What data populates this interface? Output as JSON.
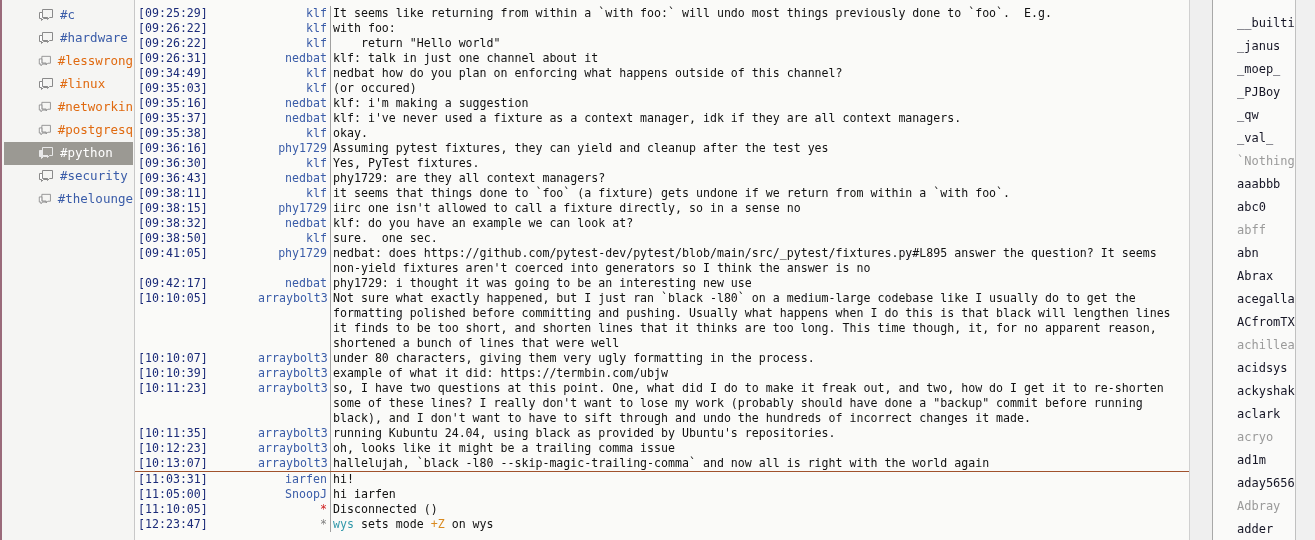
{
  "channels": [
    {
      "name": "#c",
      "color": "#3a5ca8",
      "selected": false
    },
    {
      "name": "#hardware",
      "color": "#3a5ca8",
      "selected": false
    },
    {
      "name": "#lesswrong",
      "color": "#e06a10",
      "selected": false
    },
    {
      "name": "#linux",
      "color": "#e06a10",
      "selected": false
    },
    {
      "name": "#networkin",
      "color": "#e06a10",
      "selected": false
    },
    {
      "name": "#postgresq",
      "color": "#e06a10",
      "selected": false
    },
    {
      "name": "#python",
      "color": "#ffffff",
      "selected": true
    },
    {
      "name": "#security",
      "color": "#3a5ca8",
      "selected": false
    },
    {
      "name": "#thelounge",
      "color": "#3a5ca8",
      "selected": false
    }
  ],
  "messages": [
    {
      "kind": "message",
      "time": "[09:25:29]",
      "nick": "klf",
      "text": "It seems like returning from within a `with foo:` will undo most things previously done to `foo`.  E.g."
    },
    {
      "kind": "message",
      "time": "[09:26:22]",
      "nick": "klf",
      "text": "with foo:"
    },
    {
      "kind": "message",
      "time": "[09:26:22]",
      "nick": "klf",
      "text": "    return \"Hello world\""
    },
    {
      "kind": "message",
      "time": "[09:26:31]",
      "nick": "nedbat",
      "text": "klf: talk in just one channel about it"
    },
    {
      "kind": "message",
      "time": "[09:34:49]",
      "nick": "klf",
      "text": "nedbat how do you plan on enforcing what happens outside of this channel?"
    },
    {
      "kind": "message",
      "time": "[09:35:03]",
      "nick": "klf",
      "text": "(or occured)"
    },
    {
      "kind": "message",
      "time": "[09:35:16]",
      "nick": "nedbat",
      "text": "klf: i'm making a suggestion"
    },
    {
      "kind": "message",
      "time": "[09:35:37]",
      "nick": "nedbat",
      "text": "klf: i've never used a fixture as a context manager, idk if they are all context managers."
    },
    {
      "kind": "message",
      "time": "[09:35:38]",
      "nick": "klf",
      "text": "okay."
    },
    {
      "kind": "message",
      "time": "[09:36:16]",
      "nick": "phy1729",
      "text": "Assuming pytest fixtures, they can yield and cleanup after the test yes"
    },
    {
      "kind": "message",
      "time": "[09:36:30]",
      "nick": "klf",
      "text": "Yes, PyTest fixtures."
    },
    {
      "kind": "message",
      "time": "[09:36:43]",
      "nick": "nedbat",
      "text": "phy1729: are they all context managers?"
    },
    {
      "kind": "message",
      "time": "[09:38:11]",
      "nick": "klf",
      "text": "it seems that things done to `foo` (a fixture) gets undone if we return from within a `with foo`."
    },
    {
      "kind": "message",
      "time": "[09:38:15]",
      "nick": "phy1729",
      "text": "iirc one isn't allowed to call a fixture directly, so in a sense no"
    },
    {
      "kind": "message",
      "time": "[09:38:32]",
      "nick": "nedbat",
      "text": "klf: do you have an example we can look at?"
    },
    {
      "kind": "message",
      "time": "[09:38:50]",
      "nick": "klf",
      "text": "sure.  one sec."
    },
    {
      "kind": "message",
      "time": "[09:41:05]",
      "nick": "phy1729",
      "text": "nedbat: does https://github.com/pytest-dev/pytest/blob/main/src/_pytest/fixtures.py#L895 answer the question? It seems non-yield fixtures aren't coerced into generators so I think the answer is no"
    },
    {
      "kind": "message",
      "time": "[09:42:17]",
      "nick": "nedbat",
      "text": "phy1729: i thought it was going to be an interesting new use"
    },
    {
      "kind": "message",
      "time": "[10:10:05]",
      "nick": "arraybolt3",
      "text": "Not sure what exactly happened, but I just ran `black -l80` on a medium-large codebase like I usually do to get the formatting polished before committing and pushing. Usually what happens when I do this is that black will lengthen lines it finds to be too short, and shorten lines that it thinks are too long. This time though, it, for no apparent reason, shortened a bunch of lines that were well"
    },
    {
      "kind": "message",
      "time": "[10:10:07]",
      "nick": "arraybolt3",
      "text": "under 80 characters, giving them very ugly formatting in the process."
    },
    {
      "kind": "message",
      "time": "[10:10:39]",
      "nick": "arraybolt3",
      "text": "example of what it did: https://termbin.com/ubjw"
    },
    {
      "kind": "message",
      "time": "[10:11:23]",
      "nick": "arraybolt3",
      "text": "so, I have two questions at this point. One, what did I do to make it freak out, and two, how do I get it to re-shorten some of these lines? I really don't want to lose my work (probably should have done a \"backup\" commit before running black), and I don't want to have to sift through and undo the hundreds of incorrect changes it made."
    },
    {
      "kind": "message",
      "time": "[10:11:35]",
      "nick": "arraybolt3",
      "text": "running Kubuntu 24.04, using black as provided by Ubuntu's repositories."
    },
    {
      "kind": "message",
      "time": "[10:12:23]",
      "nick": "arraybolt3",
      "text": "oh, looks like it might be a trailing comma issue"
    },
    {
      "kind": "message",
      "time": "[10:13:07]",
      "nick": "arraybolt3",
      "text": "hallelujah, `black -l80 --skip-magic-trailing-comma` and now all is right with the world again"
    },
    {
      "kind": "marker"
    },
    {
      "kind": "message",
      "time": "[11:03:31]",
      "nick": "iarfen",
      "text": "hi!"
    },
    {
      "kind": "message",
      "time": "[11:05:00]",
      "nick": "SnoopJ",
      "text": "hi iarfen"
    },
    {
      "kind": "error",
      "time": "[11:10:05]",
      "nick": "*",
      "text": "Disconnected ()"
    },
    {
      "kind": "mode",
      "time": "[12:23:47]",
      "nick": "*",
      "parts": [
        {
          "kind": "nick",
          "text": "wys"
        },
        {
          "kind": "plain",
          "text": " sets mode "
        },
        {
          "kind": "mode",
          "text": "+Z"
        },
        {
          "kind": "plain",
          "text": " on wys"
        }
      ]
    }
  ],
  "users": [
    {
      "name": "__builti",
      "away": false
    },
    {
      "name": "_janus",
      "away": false
    },
    {
      "name": "_moep_",
      "away": false
    },
    {
      "name": "_PJBoy",
      "away": false
    },
    {
      "name": "_qw",
      "away": false
    },
    {
      "name": "_val_",
      "away": false
    },
    {
      "name": "`Nothing",
      "away": true
    },
    {
      "name": "aaabbb",
      "away": false
    },
    {
      "name": "abc0",
      "away": false
    },
    {
      "name": "abff",
      "away": true
    },
    {
      "name": "abn",
      "away": false
    },
    {
      "name": "Abrax",
      "away": false
    },
    {
      "name": "acegalla",
      "away": false
    },
    {
      "name": "ACfromTX",
      "away": false
    },
    {
      "name": "achillea",
      "away": true
    },
    {
      "name": "acidsys",
      "away": false
    },
    {
      "name": "ackyshak",
      "away": false
    },
    {
      "name": "aclark",
      "away": false
    },
    {
      "name": "acryo",
      "away": true
    },
    {
      "name": "ad1m",
      "away": false
    },
    {
      "name": "aday5656",
      "away": false
    },
    {
      "name": "Adbray",
      "away": true
    },
    {
      "name": "adder",
      "away": false
    }
  ]
}
